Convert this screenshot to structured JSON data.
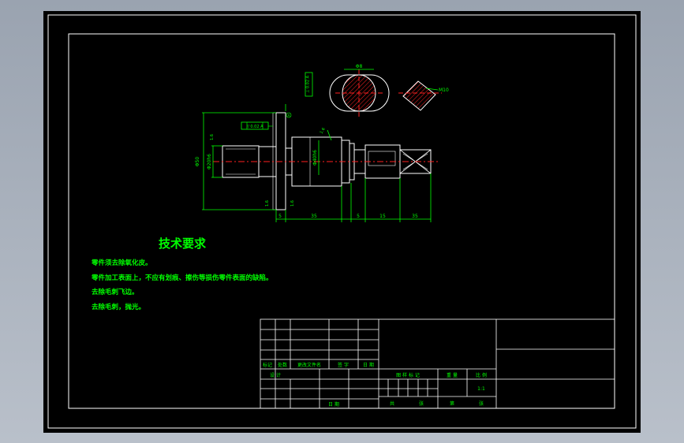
{
  "drawing": {
    "tech_title": "技术要求",
    "tech_notes": [
      "零件须去除氧化皮。",
      "零件加工表面上，不应有划痕、擦伤等损伤零件表面的缺陷。",
      "去除毛刺飞边。",
      "去除毛刺，抛光。"
    ],
    "dims": {
      "section_a": "Φ8",
      "section_b": "M10",
      "tolerance_frame": "// 0.02 A",
      "tolerance_vertical": "⊥ 0.02 A",
      "datum": "A",
      "height_overall": "Φ50",
      "dia_left": "Φ20h6",
      "dia_mid": "Φ40h6",
      "roughness_1": "1.6",
      "roughness_2": "1.6",
      "roughness_3": "1.6",
      "roughness_4": "1.6",
      "len_5a": "5",
      "len_mid": "35",
      "len_5b": "5",
      "len_15": "15",
      "len_35": "35"
    }
  },
  "title_block": {
    "row_labels": [
      "标记",
      "处数",
      "更改文件名",
      "签 字",
      "日 期"
    ],
    "design": "设 计",
    "date": "日 期",
    "stage_marks": "图 样 标 记",
    "weight": "重 量",
    "scale": "比 例",
    "scale_value": "1:1",
    "total": "共",
    "sheets": "张",
    "sheet_no": "第",
    "sheets2": "张"
  },
  "colors": {
    "background": "#000000",
    "frame": "#ffffff",
    "dimension": "#00ff00",
    "center_line": "#ff2020",
    "hatch": "#ff2020",
    "note_text": "#00ff00",
    "title_text": "#00ff00"
  }
}
